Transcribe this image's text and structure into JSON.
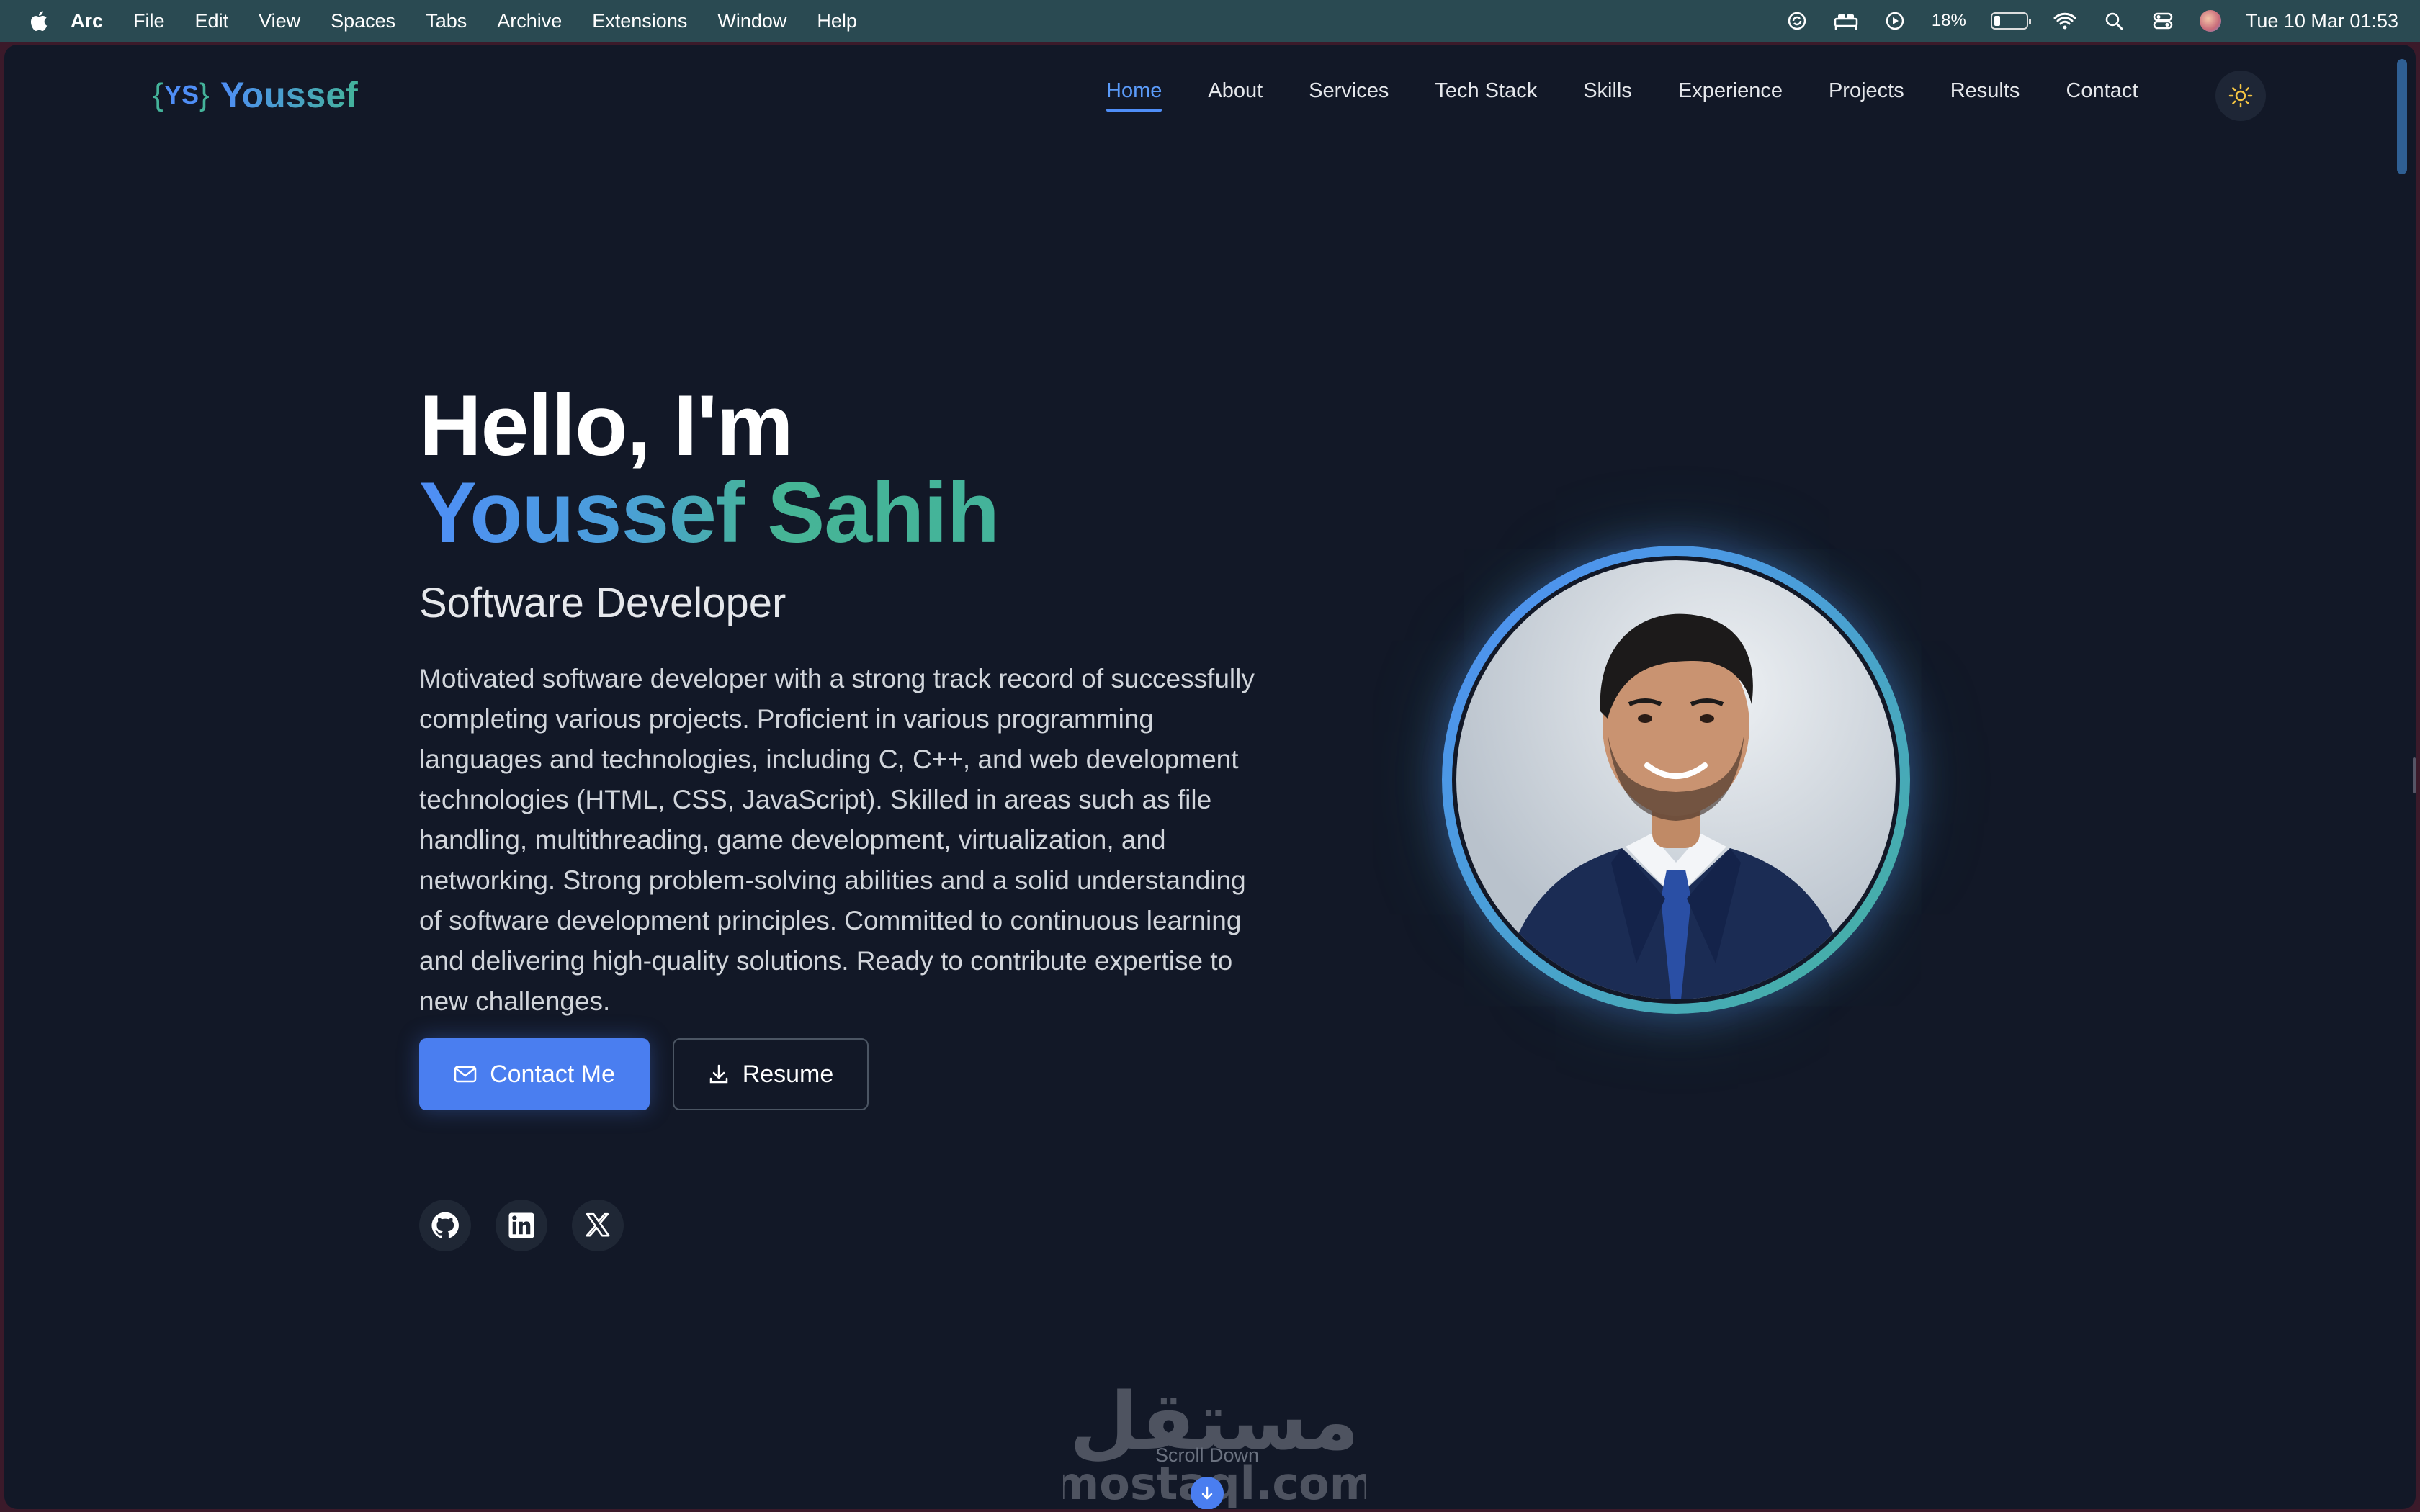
{
  "menubar": {
    "app": "Arc",
    "items": [
      "File",
      "Edit",
      "View",
      "Spaces",
      "Tabs",
      "Archive",
      "Extensions",
      "Window",
      "Help"
    ],
    "battery": "18%",
    "datetime": "Tue 10 Mar  01:53"
  },
  "site": {
    "logo_mark": "YS",
    "logo_text": "Youssef",
    "nav": [
      {
        "label": "Home",
        "active": true
      },
      {
        "label": "About"
      },
      {
        "label": "Services"
      },
      {
        "label": "Tech Stack"
      },
      {
        "label": "Skills"
      },
      {
        "label": "Experience"
      },
      {
        "label": "Projects"
      },
      {
        "label": "Results"
      },
      {
        "label": "Contact"
      }
    ]
  },
  "hero": {
    "greeting": "Hello, I'm",
    "name": "Youssef Sahih",
    "role": "Software Developer",
    "bio": "Motivated software developer with a strong track record of successfully completing various projects. Proficient in various programming languages and technologies, including C, C++, and web development technologies (HTML, CSS, JavaScript). Skilled in areas such as file handling, multithreading, game development, virtualization, and networking. Strong problem-solving abilities and a solid understanding of software development principles. Committed to continuous learning and delivering high-quality solutions. Ready to contribute expertise to new challenges.",
    "contact_button": "Contact Me",
    "resume_button": "Resume",
    "socials": [
      "github-icon",
      "linkedin-icon",
      "x-icon"
    ]
  },
  "scroll": {
    "label": "Scroll Down"
  },
  "watermark": {
    "arabic": "مستقل",
    "latin": "mostaql.com"
  },
  "colors": {
    "accent": "#4f8ef7",
    "accent2": "#44b39a",
    "background": "#121827"
  }
}
